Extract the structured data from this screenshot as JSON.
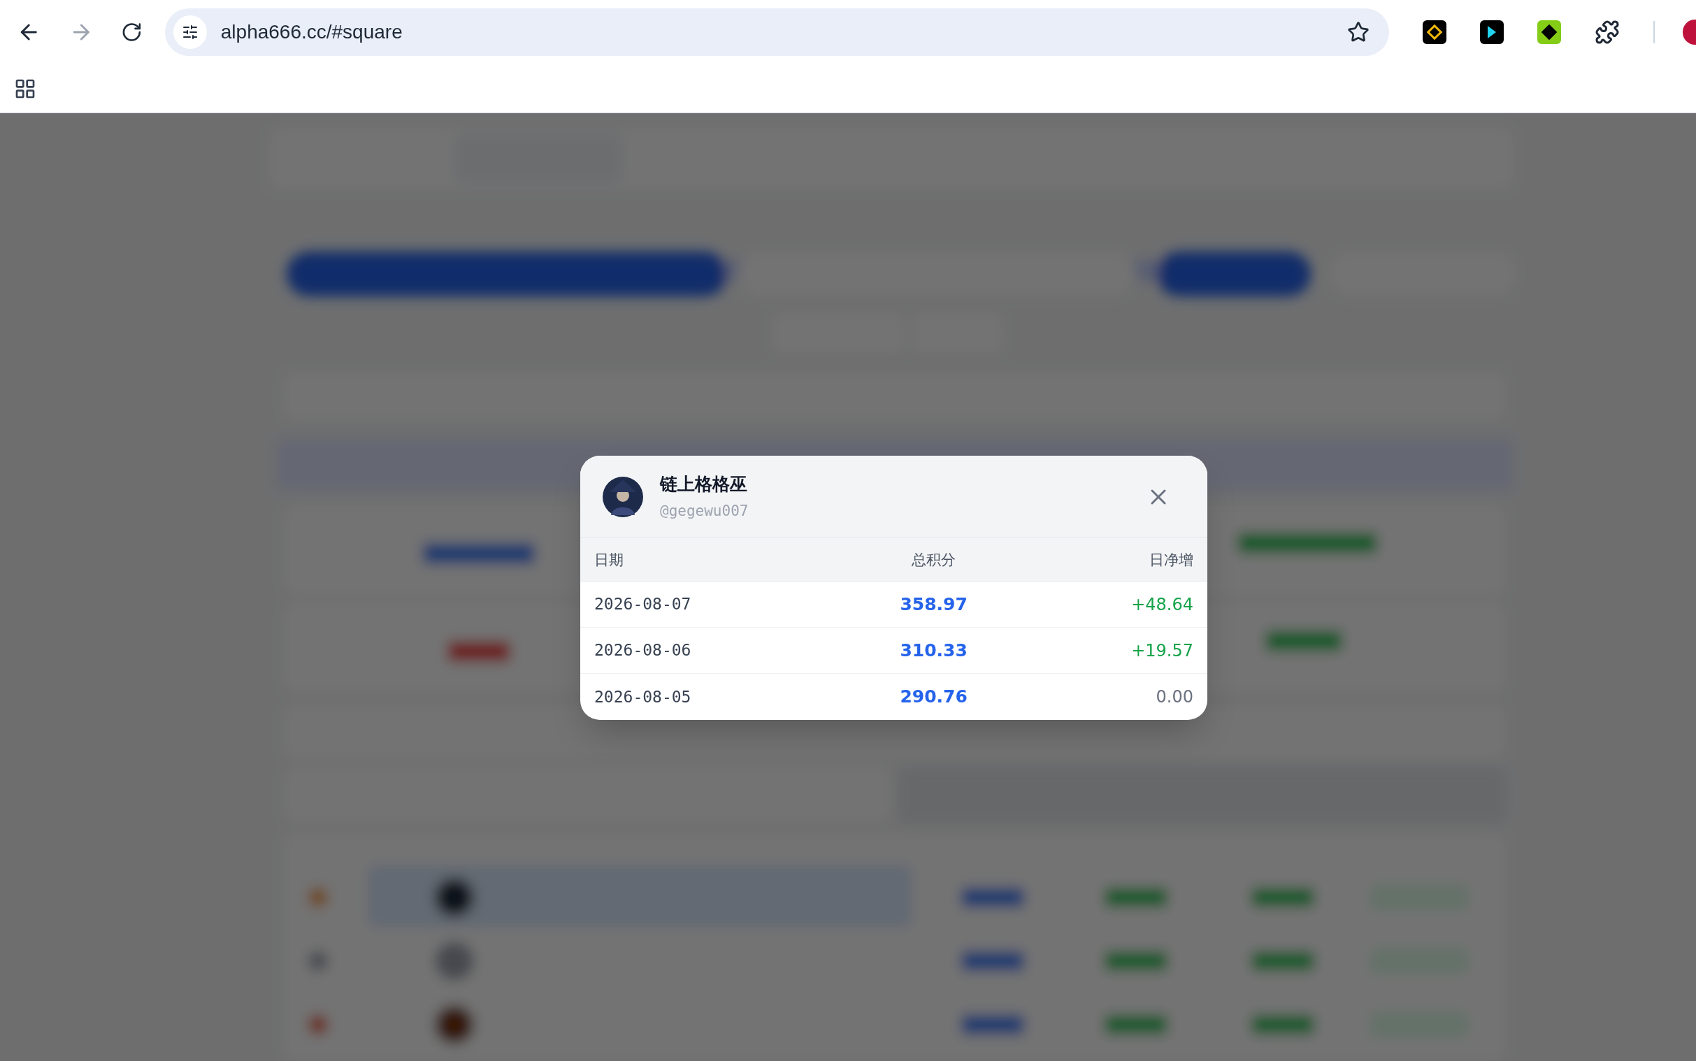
{
  "browser": {
    "url": "alpha666.cc/#square"
  },
  "modal": {
    "name": "链上格格巫",
    "handle": "@gegewu007",
    "columns": [
      "日期",
      "总积分",
      "日净增"
    ],
    "rows": [
      {
        "date": "2026-08-07",
        "total": "358.97",
        "change": "+48.64",
        "color": "#16a34a"
      },
      {
        "date": "2026-08-06",
        "total": "310.33",
        "change": "+19.57",
        "color": "#16a34a"
      },
      {
        "date": "2026-08-05",
        "total": "290.76",
        "change": "0.00",
        "color": "#6b7280"
      }
    ]
  }
}
